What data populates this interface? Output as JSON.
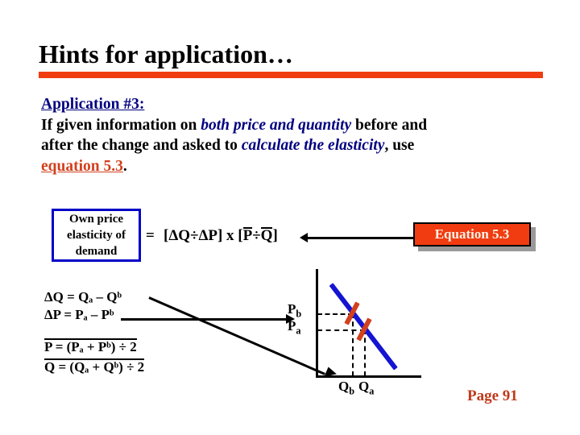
{
  "slide": {
    "title": "Hints for application…",
    "rule_color": "#f03c10",
    "page_number": "Page 91"
  },
  "body": {
    "heading": "Application #3:",
    "line1_part1": "If given information on ",
    "line1_emph": "both price and quantity",
    "line1_part2": " before and",
    "line2_part1": "after the change and asked to ",
    "line2_emph": "calculate the elasticity",
    "line2_part2": ", use",
    "line3_link": "equation 5.3",
    "line3_tail": ".",
    "heading_color": "#000080",
    "emph_color": "#000080",
    "link_color": "#d2401e"
  },
  "formula": {
    "box_line1": "Own price",
    "box_line2": "elasticity of",
    "box_line3": "demand",
    "box_border_color": "#0000c8",
    "equals": "=",
    "expr_left": "[ΔQ÷ΔP]",
    "expr_times": "x",
    "expr_bracket_open": "[",
    "expr_pbar": "P",
    "expr_divide": "÷",
    "expr_qbar": "Q",
    "expr_bracket_close": "]"
  },
  "callout": {
    "label": "Equation 5.3",
    "bg_color": "#f03c10",
    "text_color": "#fdf3e7",
    "border_color": "#000000",
    "shadow_color": "#9a9a9a"
  },
  "definitions": {
    "delta_q": "ΔQ = Qₐ – Qᵇ",
    "delta_p": "ΔP = Pₐ – Pᵇ",
    "p_bar": "P = (Pₐ + Pᵇ) ÷ 2",
    "q_bar": "Q = (Qₐ + Qᵇ) ÷ 2"
  },
  "graph": {
    "curve_color": "#1414d2",
    "point_marker_color": "#d2401e",
    "axis_color": "#000000",
    "label_pb": "P",
    "label_pb_sub": "b",
    "label_pa": "P",
    "label_pa_sub": "a",
    "label_qb": "Q",
    "label_qb_sub": "b",
    "label_qa": "Q",
    "label_qa_sub": "a"
  }
}
